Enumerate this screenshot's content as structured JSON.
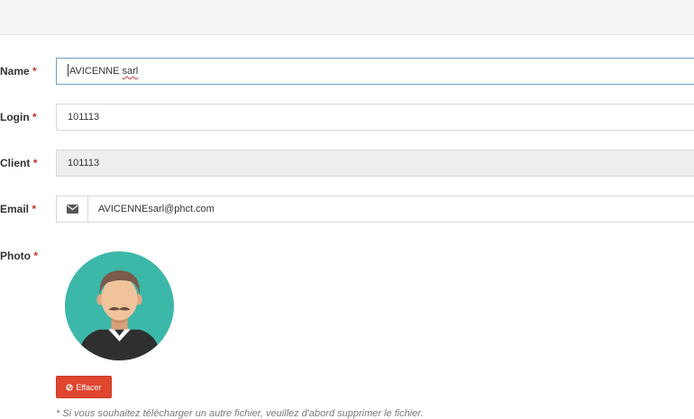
{
  "form": {
    "name": {
      "label": "Name",
      "required_mark": "*",
      "value": "AVICENNE sarl",
      "value_plain": "AVICENNE ",
      "value_misspelled": "sarl"
    },
    "login": {
      "label": "Login",
      "required_mark": "*",
      "value": "101113"
    },
    "client": {
      "label": "Client",
      "required_mark": "*",
      "value": "101113"
    },
    "email": {
      "label": "Email",
      "required_mark": "*",
      "value": "AVICENNEsarl@phct.com",
      "icon": "envelope-icon"
    },
    "photo": {
      "label": "Photo",
      "required_mark": "*",
      "avatar": "user-avatar-male"
    },
    "delete_button": {
      "label": "Effacer",
      "icon": "ban-icon",
      "color": "#e0452e"
    },
    "note": "* Si vous souhaitez télécharger un autre fichier, veuillez d'abord supprimer le fichier."
  },
  "colors": {
    "required": "#c9302c",
    "focus_border": "#6ca0c9",
    "readonly_bg": "#eeeeee",
    "avatar_bg": "#3cb8a9"
  }
}
